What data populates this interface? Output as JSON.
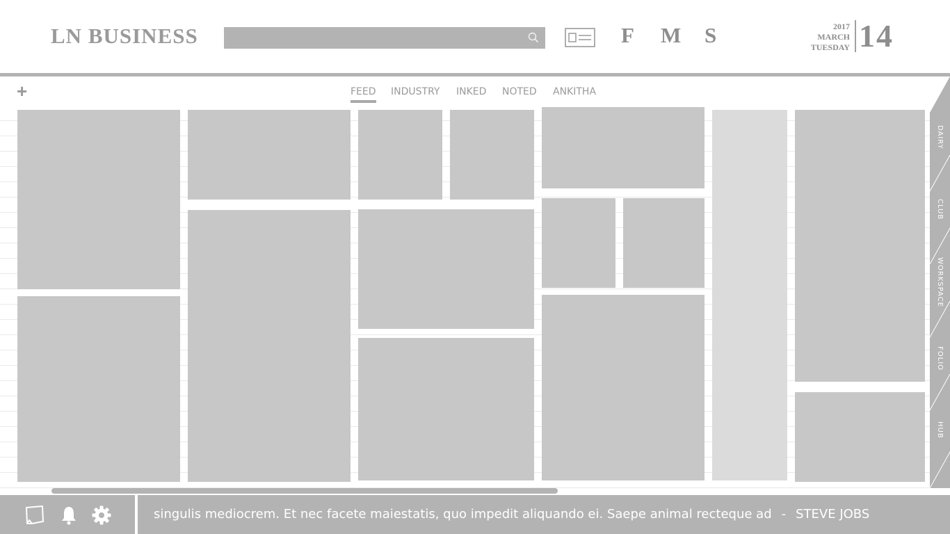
{
  "header": {
    "logo": "LN BUSINESS",
    "search_placeholder": "",
    "buttons": [
      "F",
      "M",
      "S"
    ]
  },
  "date": {
    "year": "2017",
    "month": "MARCH",
    "weekday": "TUESDAY",
    "day": "14"
  },
  "tabs": [
    {
      "label": "FEED",
      "active": true
    },
    {
      "label": "INDUSTRY",
      "active": false
    },
    {
      "label": "INKED",
      "active": false
    },
    {
      "label": "NOTED",
      "active": false
    },
    {
      "label": "ANKITHA",
      "active": false
    }
  ],
  "add_label": "+",
  "side_tabs": [
    "DAIRY",
    "CLUB",
    "WORKSPACE",
    "FOLIO",
    "HUB"
  ],
  "footer": {
    "quote": "singulis mediocrem. Et nec facete maiestatis, quo impedit aliquando ei. Saepe animal recteque ad",
    "separator": "-",
    "author": "STEVE JOBS"
  },
  "colors": {
    "tile": "#c8c7c8",
    "tile_light": "#dcdbdc",
    "chrome": "#b3b3b3",
    "text_muted": "#9a9a9a"
  }
}
